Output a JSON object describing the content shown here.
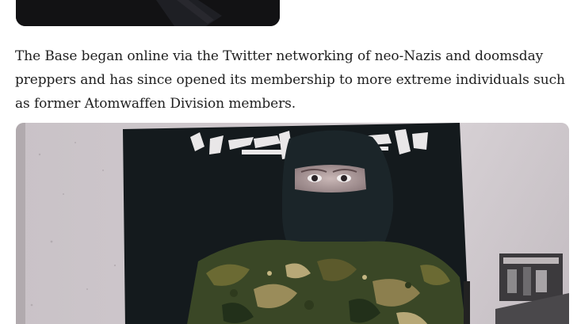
{
  "article": {
    "paragraph": "The Base began online via the Twitter networking of neo-Nazis and doomsday preppers and has since opened its membership to more extreme individuals such as former Atomwaffen Division members."
  },
  "images": {
    "top_image": "dark-photo",
    "main_image": "masked-person-in-camouflage-photo"
  },
  "colors": {
    "background": "#ffffff",
    "text": "#1f1f1f",
    "flag": "#141a1d",
    "wall": "#d3cdd1",
    "camo_dark": "#2e3a1d",
    "camo_mid": "#5c5a2c",
    "camo_light": "#9a8c5a"
  }
}
